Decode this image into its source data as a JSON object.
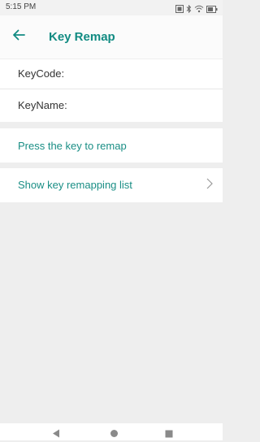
{
  "status_bar": {
    "time": "5:15 PM",
    "icons": [
      "screenshot-icon",
      "bluetooth-icon",
      "wifi-icon",
      "battery-icon"
    ]
  },
  "app_bar": {
    "back_icon": "arrow-left-icon",
    "title": "Key Remap"
  },
  "info": {
    "keycode_label": "KeyCode:",
    "keyname_label": "KeyName:"
  },
  "actions": {
    "press_key_label": "Press the key to remap",
    "show_list_label": "Show key remapping list"
  },
  "nav_bar": {
    "icons": [
      "back-triangle-icon",
      "home-circle-icon",
      "recents-square-icon"
    ]
  },
  "colors": {
    "accent": "#1a8e85",
    "background": "#eeeeee",
    "surface": "#ffffff"
  }
}
